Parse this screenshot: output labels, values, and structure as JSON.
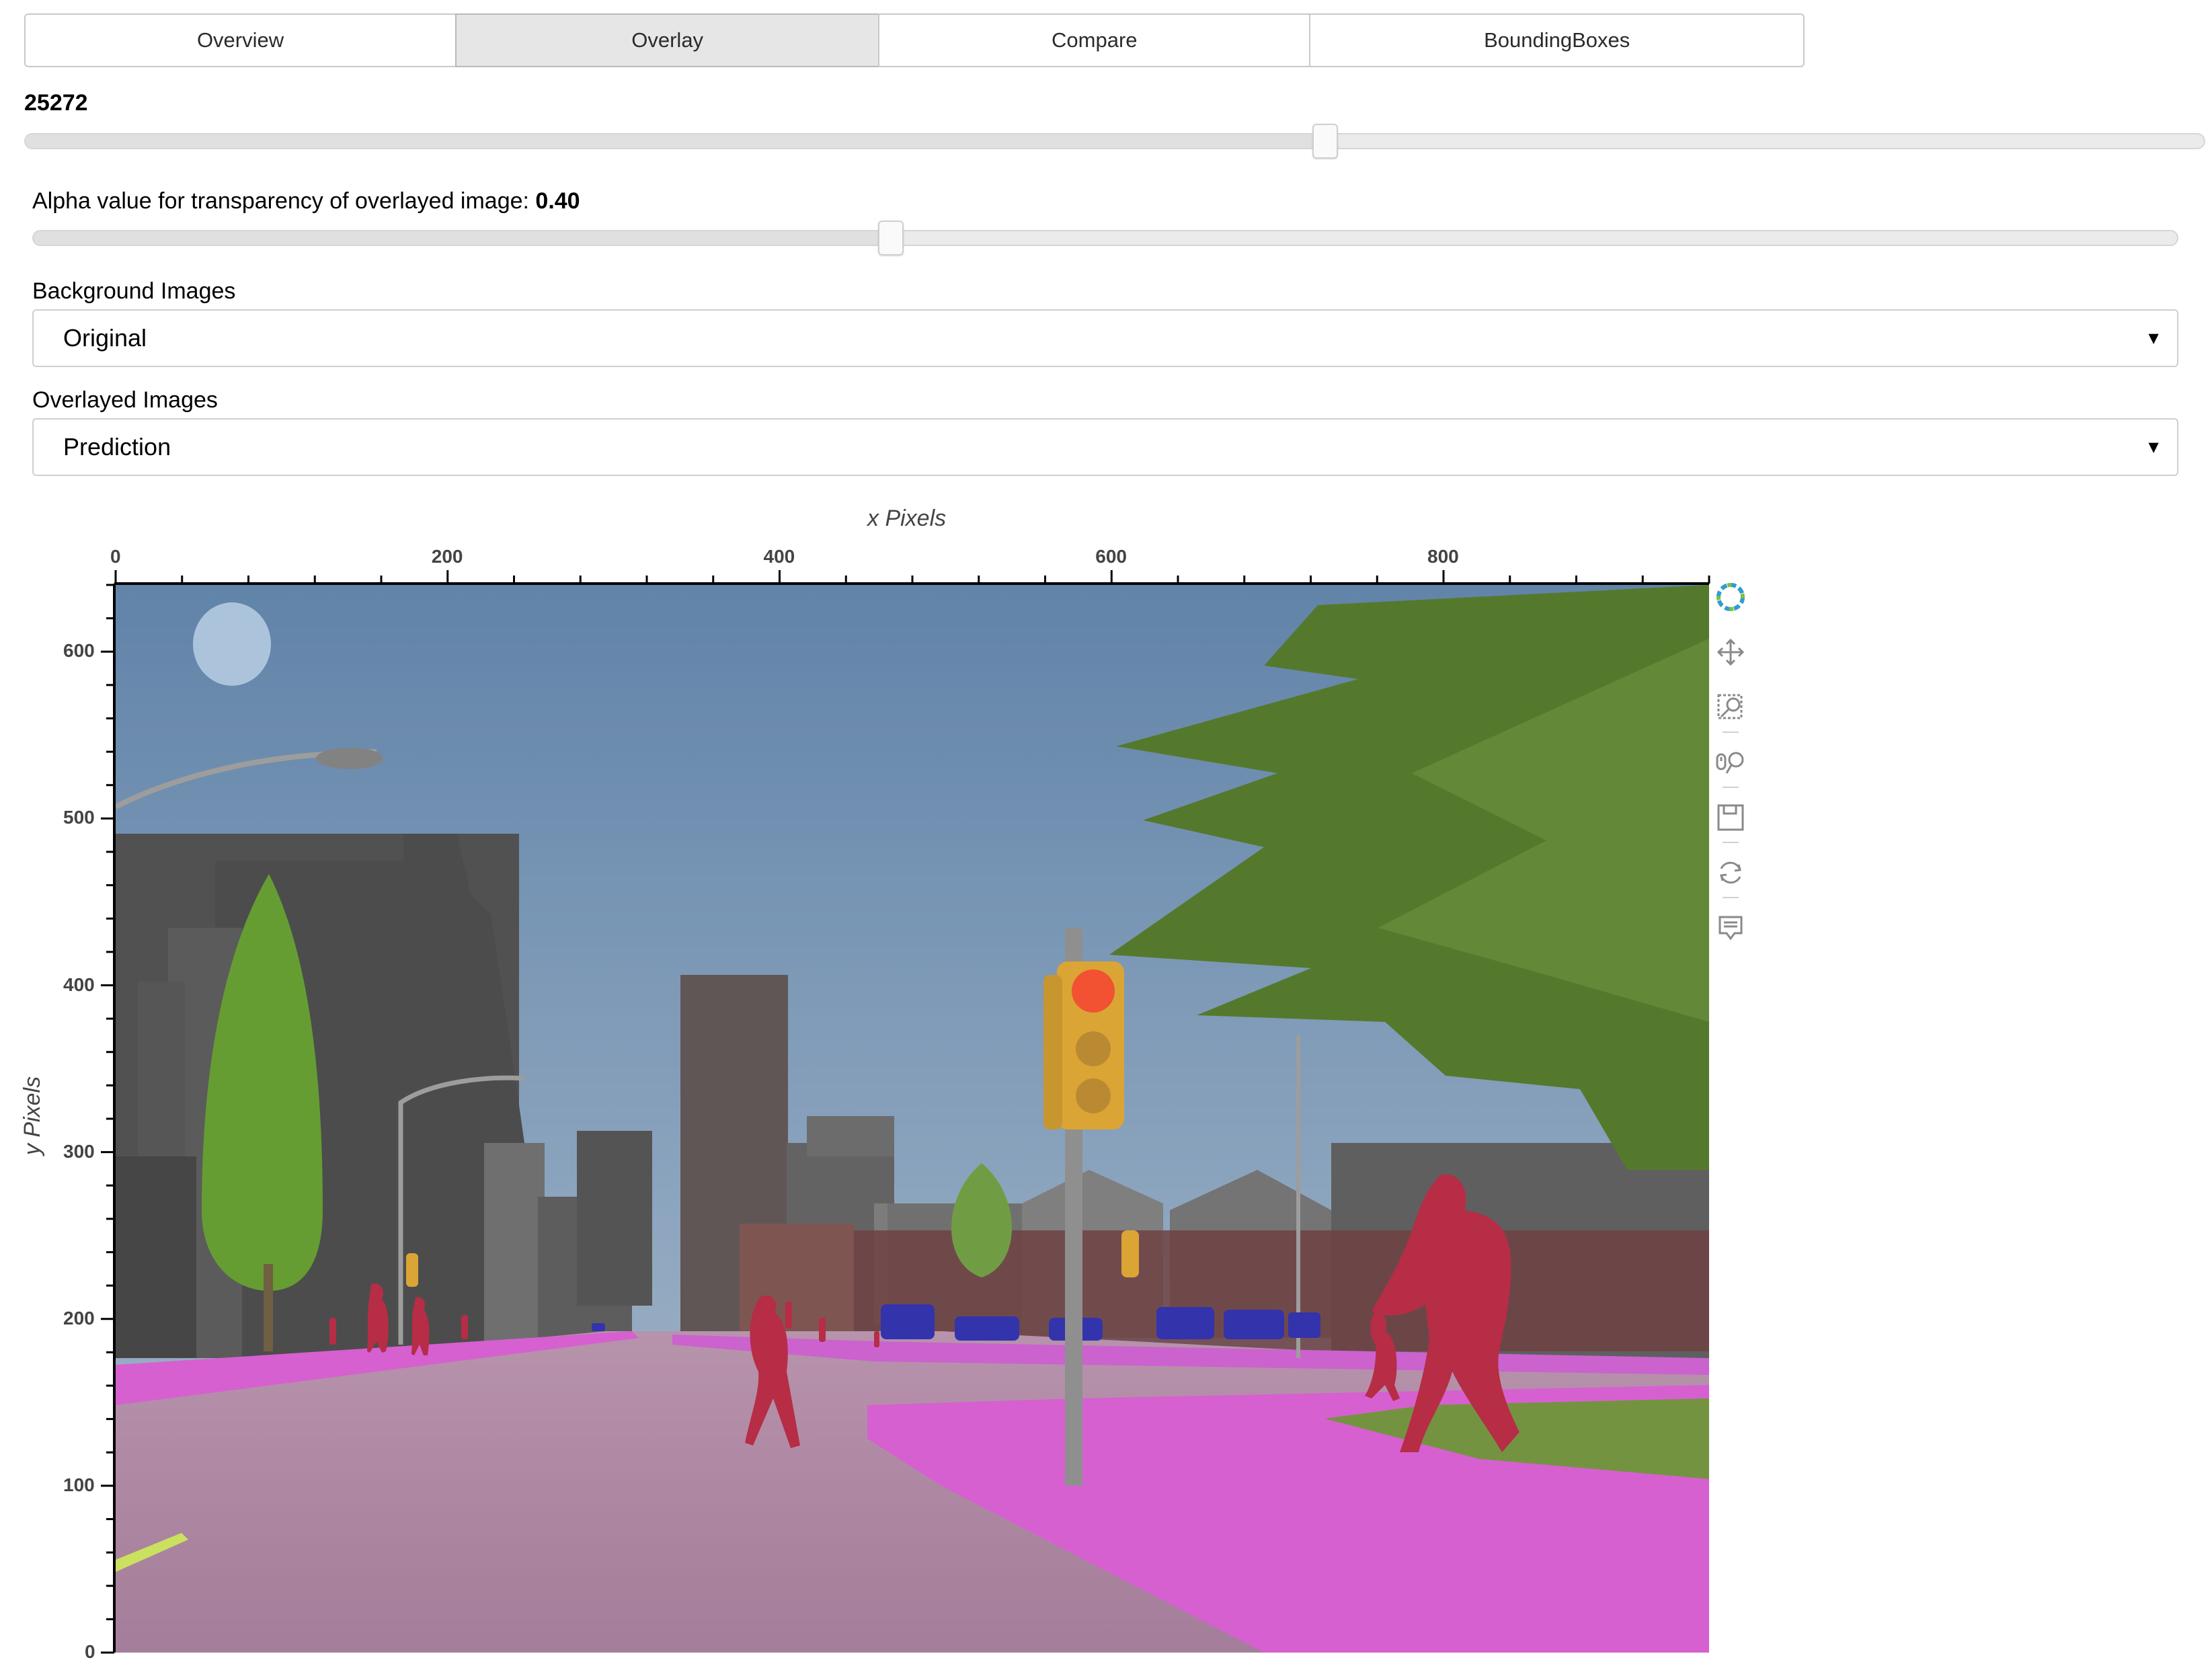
{
  "tabs": [
    {
      "label": "Overview",
      "active": false
    },
    {
      "label": "Overlay",
      "active": true
    },
    {
      "label": "Compare",
      "active": false
    },
    {
      "label": "BoundingBoxes",
      "active": false
    }
  ],
  "frame_slider": {
    "value_label": "25272",
    "fraction": 0.597
  },
  "alpha_slider": {
    "label": "Alpha value for transparency of overlayed image: ",
    "value": "0.40",
    "fraction": 0.4
  },
  "background_images": {
    "label": "Background Images",
    "selected": "Original"
  },
  "overlayed_images": {
    "label": "Overlayed Images",
    "selected": "Prediction"
  },
  "plot": {
    "x_title": "x Pixels",
    "y_title": "y Pixels",
    "x_ticks": [
      "0",
      "200",
      "400",
      "600",
      "800"
    ],
    "y_ticks": [
      "0",
      "100",
      "200",
      "300",
      "400",
      "500",
      "600"
    ],
    "x_range": [
      0,
      960
    ],
    "y_range": [
      0,
      640
    ]
  },
  "toolbar": {
    "items": [
      "bokeh-logo-icon",
      "pan-icon",
      "box-zoom-icon",
      "wheel-zoom-icon",
      "save-icon",
      "reset-icon",
      "hover-icon"
    ]
  },
  "colors": {
    "road": "#a77c9b",
    "sidewalk": "#d65ad0",
    "sky": "#6f8fb0",
    "vegetation": "#5f7f2a",
    "person": "#b0243c",
    "car": "#2a2aa0",
    "traffic_light": "#d9a12c"
  }
}
